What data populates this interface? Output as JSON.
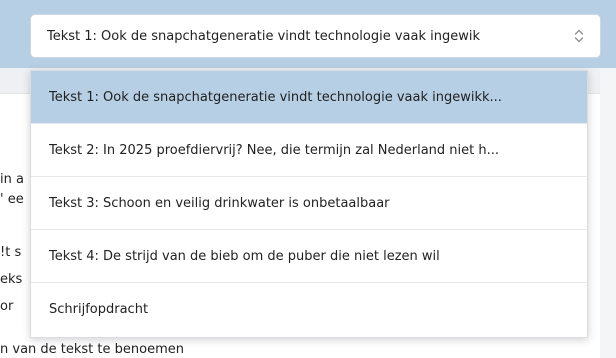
{
  "select": {
    "value": "Tekst 1: Ook de snapchatgeneratie vindt technologie vaak ingewik",
    "icon": "chevron-up-down-icon"
  },
  "dropdown": {
    "options": [
      {
        "label": "Tekst 1: Ook de snapchatgeneratie vindt technologie vaak ingewikk...",
        "selected": true
      },
      {
        "label": "Tekst 2: In 2025 proefdiervrij? Nee, die termijn zal Nederland niet h...",
        "selected": false
      },
      {
        "label": "Tekst 3: Schoon en veilig drinkwater is onbetaalbaar",
        "selected": false
      },
      {
        "label": "Tekst 4: De strijd van de bieb om de puber die niet lezen wil",
        "selected": false
      },
      {
        "label": "Schrijfopdracht",
        "selected": false
      }
    ]
  },
  "background": {
    "fragments": [
      "in a",
      "' ee",
      "!t s",
      "eks",
      " or"
    ],
    "bottom_line": "n van de tekst te benoemen"
  },
  "colors": {
    "accent": "#b7cfe5",
    "border": "#d9dde2"
  }
}
